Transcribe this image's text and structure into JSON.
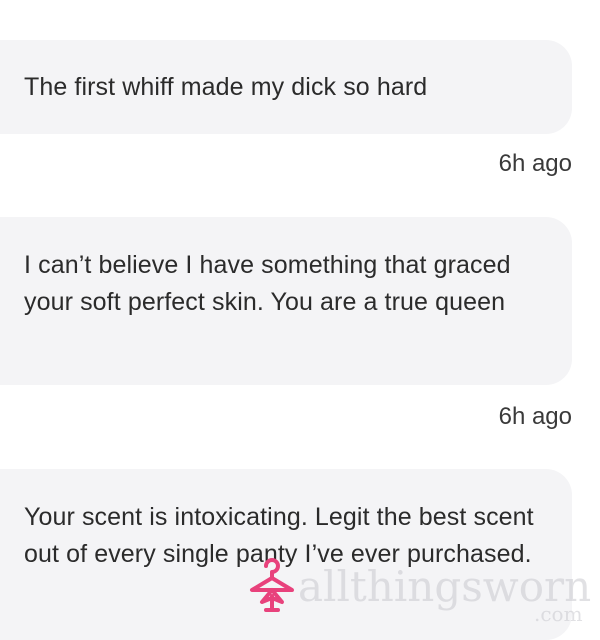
{
  "messages": [
    {
      "text": "The first whiff made my dick so hard",
      "time": "6h ago"
    },
    {
      "text": "I can’t believe I have something that graced your soft perfect skin. You are a true queen",
      "time": "6h ago"
    },
    {
      "text": "Your scent is intoxicating. Legit the best scent out of every single panty I’ve ever purchased."
    }
  ],
  "watermark": {
    "text": "allthingsworn",
    "suffix": ".com",
    "logo_icon": "hanger-bow-icon",
    "logo_color": "#e8427c"
  },
  "colors": {
    "bubble_bg": "#f4f4f6",
    "text": "#2b2b2b"
  }
}
